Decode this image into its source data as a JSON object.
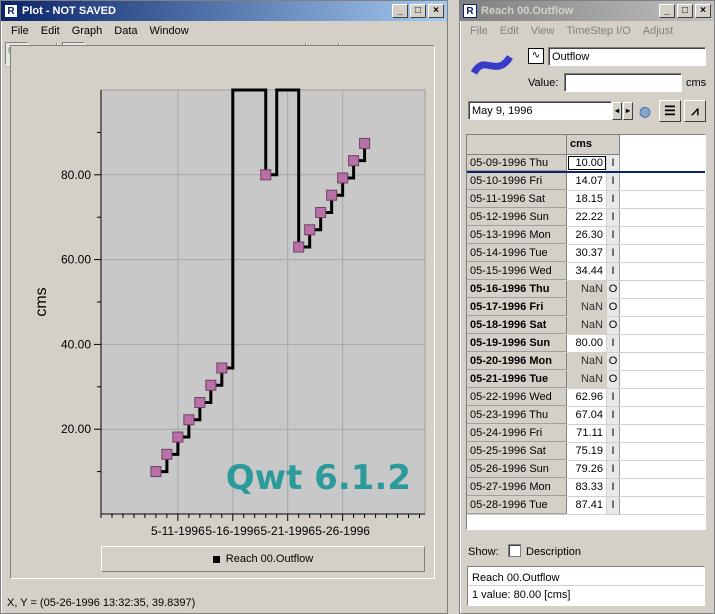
{
  "plot_window": {
    "title": "Plot - NOT SAVED",
    "menu": [
      "File",
      "Edit",
      "Graph",
      "Data",
      "Window"
    ],
    "watermark": "Qwt 6.1.2",
    "legend_label": "Reach 00.Outflow",
    "status": "X, Y = (05-26-1996 13:32:35, 39.8397)"
  },
  "chart_data": {
    "type": "line",
    "step": true,
    "ylabel": "cms",
    "ylim": [
      0,
      100
    ],
    "yticks": [
      20,
      40,
      60,
      80
    ],
    "ytick_labels": [
      "20.00",
      "40.00",
      "60.00",
      "80.00"
    ],
    "xticks": [
      2,
      7,
      12,
      17
    ],
    "xtick_labels": [
      "5-11-1996",
      "5-16-1996",
      "5-21-1996",
      "5-26-1996"
    ],
    "series": [
      {
        "x": [
          0,
          1,
          2,
          3,
          4,
          5,
          6,
          7,
          8,
          9,
          10,
          11,
          12,
          13,
          14,
          15,
          16,
          17,
          18,
          19
        ],
        "values": [
          10.0,
          14.07,
          18.15,
          22.22,
          26.3,
          30.37,
          34.44,
          null,
          null,
          null,
          80.0,
          null,
          null,
          62.96,
          67.04,
          71.11,
          75.19,
          79.26,
          83.33,
          87.41
        ],
        "marker_color": "#b870a8"
      }
    ]
  },
  "data_window": {
    "title": "Reach 00.Outflow",
    "menu": [
      "File",
      "Edit",
      "View",
      "TimeStep I/O",
      "Adjust"
    ],
    "slot_name": "Outflow",
    "value_label": "Value:",
    "value_units": "cms",
    "date": "May 9, 1996",
    "column_header": "cms",
    "rows": [
      {
        "date": "05-09-1996 Thu",
        "value": "10.00",
        "flag": "I",
        "bold": false
      },
      {
        "date": "05-10-1996 Fri",
        "value": "14.07",
        "flag": "I",
        "bold": false
      },
      {
        "date": "05-11-1996 Sat",
        "value": "18.15",
        "flag": "I",
        "bold": false
      },
      {
        "date": "05-12-1996 Sun",
        "value": "22.22",
        "flag": "I",
        "bold": false
      },
      {
        "date": "05-13-1996 Mon",
        "value": "26.30",
        "flag": "I",
        "bold": false
      },
      {
        "date": "05-14-1996 Tue",
        "value": "30.37",
        "flag": "I",
        "bold": false
      },
      {
        "date": "05-15-1996 Wed",
        "value": "34.44",
        "flag": "I",
        "bold": false
      },
      {
        "date": "05-16-1996 Thu",
        "value": "NaN",
        "flag": "O",
        "bold": true
      },
      {
        "date": "05-17-1996 Fri",
        "value": "NaN",
        "flag": "O",
        "bold": true
      },
      {
        "date": "05-18-1996 Sat",
        "value": "NaN",
        "flag": "O",
        "bold": true
      },
      {
        "date": "05-19-1996 Sun",
        "value": "80.00",
        "flag": "I",
        "bold": true
      },
      {
        "date": "05-20-1996 Mon",
        "value": "NaN",
        "flag": "O",
        "bold": true
      },
      {
        "date": "05-21-1996 Tue",
        "value": "NaN",
        "flag": "O",
        "bold": true
      },
      {
        "date": "05-22-1996 Wed",
        "value": "62.96",
        "flag": "I",
        "bold": false
      },
      {
        "date": "05-23-1996 Thu",
        "value": "67.04",
        "flag": "I",
        "bold": false
      },
      {
        "date": "05-24-1996 Fri",
        "value": "71.11",
        "flag": "I",
        "bold": false
      },
      {
        "date": "05-25-1996 Sat",
        "value": "75.19",
        "flag": "I",
        "bold": false
      },
      {
        "date": "05-26-1996 Sun",
        "value": "79.26",
        "flag": "I",
        "bold": false
      },
      {
        "date": "05-27-1996 Mon",
        "value": "83.33",
        "flag": "I",
        "bold": false
      },
      {
        "date": "05-28-1996 Tue",
        "value": "87.41",
        "flag": "I",
        "bold": false
      }
    ],
    "show_label": "Show:",
    "description_label": "Description",
    "info_line1": "Reach 00.Outflow",
    "info_line2": "1 value:  80.00 [cms]"
  }
}
